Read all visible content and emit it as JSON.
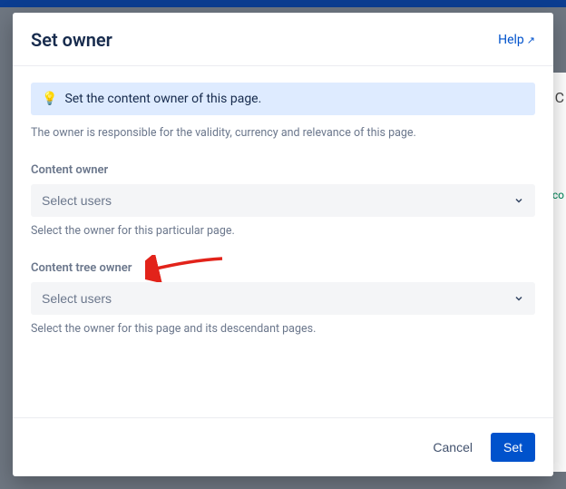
{
  "header": {
    "title": "Set owner",
    "help_label": "Help"
  },
  "banner": {
    "message": "Set the content owner of this page."
  },
  "description": "The owner is responsible for the validity, currency and relevance of this page.",
  "fields": {
    "content_owner": {
      "label": "Content owner",
      "placeholder": "Select users",
      "help": "Select the owner for this particular page."
    },
    "content_tree_owner": {
      "label": "Content tree owner",
      "placeholder": "Select users",
      "help": "Select the owner for this page and its descendant pages."
    }
  },
  "footer": {
    "cancel": "Cancel",
    "set": "Set"
  },
  "bg_fragments": {
    "c": "C",
    "co": "co"
  }
}
